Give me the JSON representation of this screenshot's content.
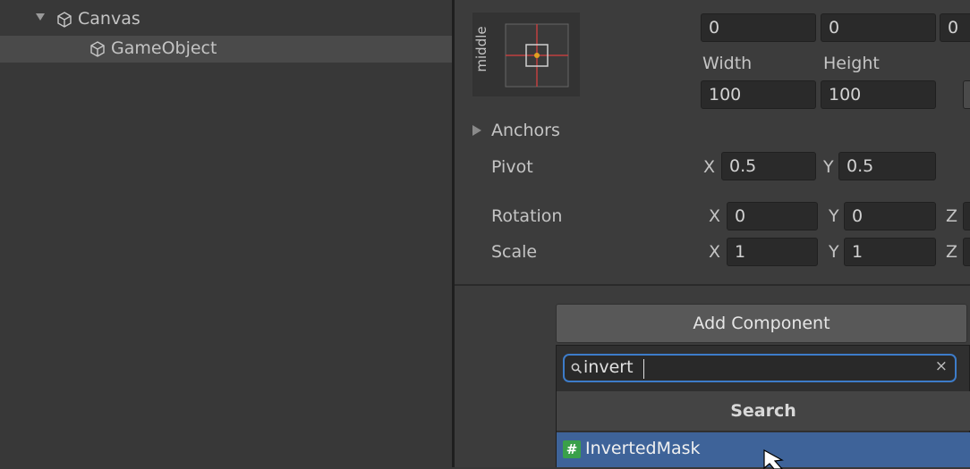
{
  "hierarchy": {
    "items": [
      {
        "label": "Canvas"
      },
      {
        "label": "GameObject"
      }
    ]
  },
  "rect_transform": {
    "anchor_preset_label": "middle",
    "pos_values": [
      "0",
      "0",
      "0"
    ],
    "width_label": "Width",
    "height_label": "Height",
    "width_value": "100",
    "height_value": "100",
    "anchors_label": "Anchors",
    "pivot": {
      "label": "Pivot",
      "x_axis": "X",
      "x_value": "0.5",
      "y_axis": "Y",
      "y_value": "0.5"
    },
    "rotation": {
      "label": "Rotation",
      "x_axis": "X",
      "x_value": "0",
      "y_axis": "Y",
      "y_value": "0",
      "z_axis": "Z"
    },
    "scale": {
      "label": "Scale",
      "x_axis": "X",
      "x_value": "1",
      "y_axis": "Y",
      "y_value": "1",
      "z_axis": "Z"
    }
  },
  "add_component": {
    "button_label": "Add Component",
    "search_value": "invert",
    "search_header": "Search",
    "results": [
      {
        "label": "InvertedMask",
        "icon": "script-hash-icon"
      }
    ]
  },
  "colors": {
    "accent": "#3d7cc9",
    "selected_row": "#3e6399"
  }
}
